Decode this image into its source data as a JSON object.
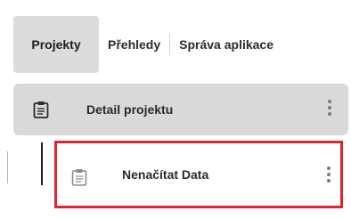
{
  "tabs": [
    {
      "label": "Projekty",
      "active": true
    },
    {
      "label": "Přehledy",
      "active": false
    },
    {
      "label": "Správa aplikace",
      "active": false
    }
  ],
  "tree": {
    "parent": {
      "label": "Detail projektu",
      "icon": "clipboard-icon",
      "menu_icon": "more-vertical-icon"
    },
    "child": {
      "label": "Nenačítat Data",
      "icon": "clipboard-icon",
      "menu_icon": "more-vertical-icon",
      "highlight_color": "#e02232"
    }
  },
  "colors": {
    "active_tab_bg": "#dcdcdc",
    "parent_row_bg": "#d9d9d9"
  }
}
